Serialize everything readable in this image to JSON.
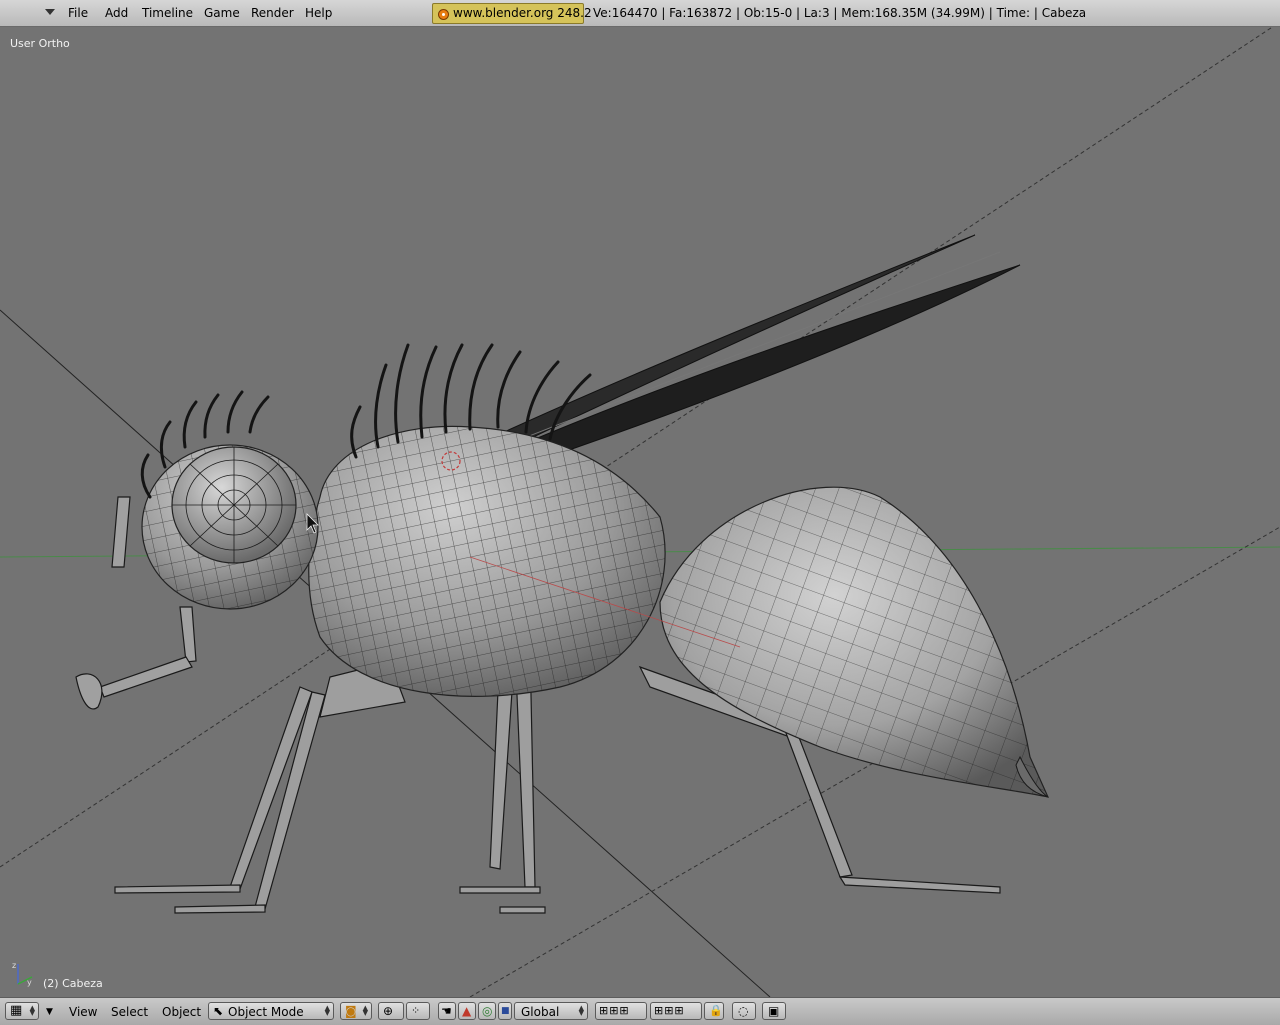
{
  "window": {
    "menu": [
      "File",
      "Add",
      "Timeline",
      "Game",
      "Render",
      "Help"
    ],
    "url_badge": "www.blender.org 248.2",
    "stats": "Ve:164470 | Fa:163872 | Ob:15-0 | La:3  | Mem:168.35M (34.99M)  | Time: | Cabeza"
  },
  "viewport": {
    "view_label": "User Ortho",
    "object_label": "(2) Cabeza"
  },
  "bottom": {
    "view": "View",
    "select": "Select",
    "object": "Object",
    "mode": "Object Mode",
    "orientation": "Global"
  },
  "icons": {
    "editor_type": "grid-icon",
    "mode": "object-mode-icon",
    "draw_type": "solid-draw-icon",
    "pivot": "pivot-icon",
    "manipulator_toggle": "hand-icon",
    "translate": "translate-icon",
    "rotate": "rotate-icon",
    "scale": "scale-icon",
    "lock": "lock-icon",
    "render": "render-icon"
  },
  "colors": {
    "viewport_bg": "#737373",
    "header_bg": "#b9b9b9",
    "url_badge": "#d5c35a"
  }
}
